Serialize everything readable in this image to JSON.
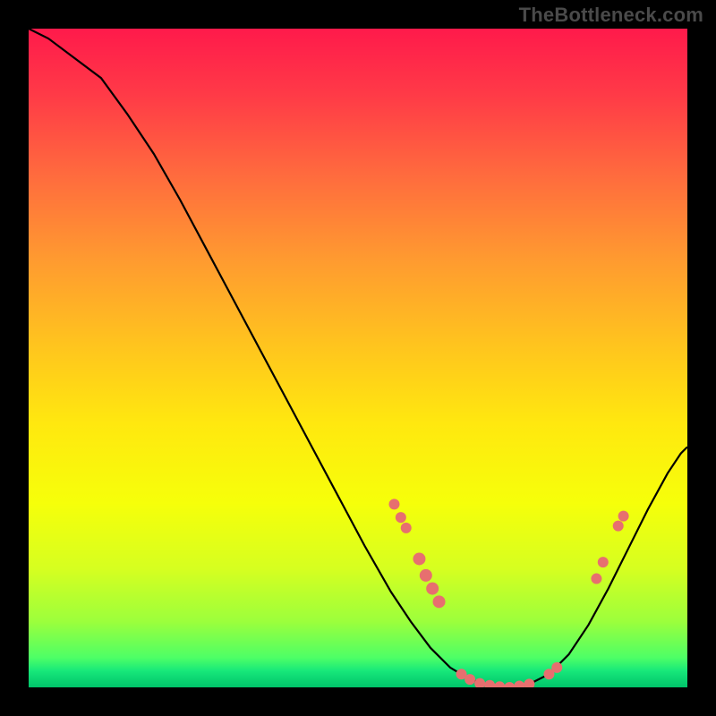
{
  "watermark": "TheBottleneck.com",
  "gradient": {
    "stops": [
      {
        "offset": 0.0,
        "color": "#ff1a4b"
      },
      {
        "offset": 0.1,
        "color": "#ff3a47"
      },
      {
        "offset": 0.22,
        "color": "#ff6a3e"
      },
      {
        "offset": 0.35,
        "color": "#ff9a30"
      },
      {
        "offset": 0.48,
        "color": "#ffc41e"
      },
      {
        "offset": 0.6,
        "color": "#ffe80f"
      },
      {
        "offset": 0.72,
        "color": "#f6ff0a"
      },
      {
        "offset": 0.82,
        "color": "#d6ff20"
      },
      {
        "offset": 0.9,
        "color": "#9cff3c"
      },
      {
        "offset": 0.955,
        "color": "#4dff66"
      },
      {
        "offset": 0.975,
        "color": "#17e87a"
      },
      {
        "offset": 1.0,
        "color": "#00c46a"
      }
    ]
  },
  "curve": {
    "color": "#000000",
    "width": 2.2,
    "points": [
      {
        "x": 0.0,
        "y": 1.0
      },
      {
        "x": 0.03,
        "y": 0.985
      },
      {
        "x": 0.07,
        "y": 0.955
      },
      {
        "x": 0.11,
        "y": 0.925
      },
      {
        "x": 0.15,
        "y": 0.87
      },
      {
        "x": 0.19,
        "y": 0.81
      },
      {
        "x": 0.23,
        "y": 0.74
      },
      {
        "x": 0.27,
        "y": 0.665
      },
      {
        "x": 0.31,
        "y": 0.59
      },
      {
        "x": 0.35,
        "y": 0.515
      },
      {
        "x": 0.39,
        "y": 0.44
      },
      {
        "x": 0.43,
        "y": 0.365
      },
      {
        "x": 0.47,
        "y": 0.29
      },
      {
        "x": 0.51,
        "y": 0.215
      },
      {
        "x": 0.55,
        "y": 0.145
      },
      {
        "x": 0.58,
        "y": 0.1
      },
      {
        "x": 0.61,
        "y": 0.06
      },
      {
        "x": 0.64,
        "y": 0.03
      },
      {
        "x": 0.67,
        "y": 0.012
      },
      {
        "x": 0.7,
        "y": 0.003
      },
      {
        "x": 0.73,
        "y": 0.0
      },
      {
        "x": 0.76,
        "y": 0.005
      },
      {
        "x": 0.79,
        "y": 0.02
      },
      {
        "x": 0.82,
        "y": 0.05
      },
      {
        "x": 0.85,
        "y": 0.095
      },
      {
        "x": 0.88,
        "y": 0.15
      },
      {
        "x": 0.91,
        "y": 0.21
      },
      {
        "x": 0.94,
        "y": 0.27
      },
      {
        "x": 0.97,
        "y": 0.325
      },
      {
        "x": 0.99,
        "y": 0.355
      },
      {
        "x": 1.0,
        "y": 0.365
      }
    ]
  },
  "markers": {
    "color": "#e76f6f",
    "shape": "circle",
    "points": [
      {
        "x": 0.555,
        "y": 0.278,
        "r": 6
      },
      {
        "x": 0.565,
        "y": 0.258,
        "r": 6
      },
      {
        "x": 0.573,
        "y": 0.242,
        "r": 6
      },
      {
        "x": 0.593,
        "y": 0.195,
        "r": 7
      },
      {
        "x": 0.603,
        "y": 0.17,
        "r": 7
      },
      {
        "x": 0.613,
        "y": 0.15,
        "r": 7
      },
      {
        "x": 0.623,
        "y": 0.13,
        "r": 7
      },
      {
        "x": 0.657,
        "y": 0.02,
        "r": 6
      },
      {
        "x": 0.67,
        "y": 0.012,
        "r": 6
      },
      {
        "x": 0.685,
        "y": 0.006,
        "r": 6
      },
      {
        "x": 0.7,
        "y": 0.003,
        "r": 6
      },
      {
        "x": 0.715,
        "y": 0.001,
        "r": 6
      },
      {
        "x": 0.73,
        "y": 0.0,
        "r": 6
      },
      {
        "x": 0.745,
        "y": 0.002,
        "r": 6
      },
      {
        "x": 0.76,
        "y": 0.005,
        "r": 6
      },
      {
        "x": 0.79,
        "y": 0.02,
        "r": 6
      },
      {
        "x": 0.802,
        "y": 0.03,
        "r": 6
      },
      {
        "x": 0.862,
        "y": 0.165,
        "r": 6
      },
      {
        "x": 0.872,
        "y": 0.19,
        "r": 6
      },
      {
        "x": 0.895,
        "y": 0.245,
        "r": 6
      },
      {
        "x": 0.903,
        "y": 0.26,
        "r": 6
      }
    ]
  },
  "chart_data": {
    "type": "line",
    "title": "",
    "xlabel": "",
    "ylabel": "",
    "xlim": [
      0,
      1
    ],
    "ylim": [
      0,
      1
    ],
    "legend": false,
    "grid": false,
    "series": [
      {
        "name": "bottleneck-curve",
        "x": [
          0.0,
          0.03,
          0.07,
          0.11,
          0.15,
          0.19,
          0.23,
          0.27,
          0.31,
          0.35,
          0.39,
          0.43,
          0.47,
          0.51,
          0.55,
          0.58,
          0.61,
          0.64,
          0.67,
          0.7,
          0.73,
          0.76,
          0.79,
          0.82,
          0.85,
          0.88,
          0.91,
          0.94,
          0.97,
          0.99,
          1.0
        ],
        "y": [
          1.0,
          0.985,
          0.955,
          0.925,
          0.87,
          0.81,
          0.74,
          0.665,
          0.59,
          0.515,
          0.44,
          0.365,
          0.29,
          0.215,
          0.145,
          0.1,
          0.06,
          0.03,
          0.012,
          0.003,
          0.0,
          0.005,
          0.02,
          0.05,
          0.095,
          0.15,
          0.21,
          0.27,
          0.325,
          0.355,
          0.365
        ]
      },
      {
        "name": "highlighted-points",
        "type": "scatter",
        "x": [
          0.555,
          0.565,
          0.573,
          0.593,
          0.603,
          0.613,
          0.623,
          0.657,
          0.67,
          0.685,
          0.7,
          0.715,
          0.73,
          0.745,
          0.76,
          0.79,
          0.802,
          0.862,
          0.872,
          0.895,
          0.903
        ],
        "y": [
          0.278,
          0.258,
          0.242,
          0.195,
          0.17,
          0.15,
          0.13,
          0.02,
          0.012,
          0.006,
          0.003,
          0.001,
          0.0,
          0.002,
          0.005,
          0.02,
          0.03,
          0.165,
          0.19,
          0.245,
          0.26
        ]
      }
    ],
    "annotations": [
      {
        "text": "TheBottleneck.com",
        "position": "top-right"
      }
    ]
  }
}
